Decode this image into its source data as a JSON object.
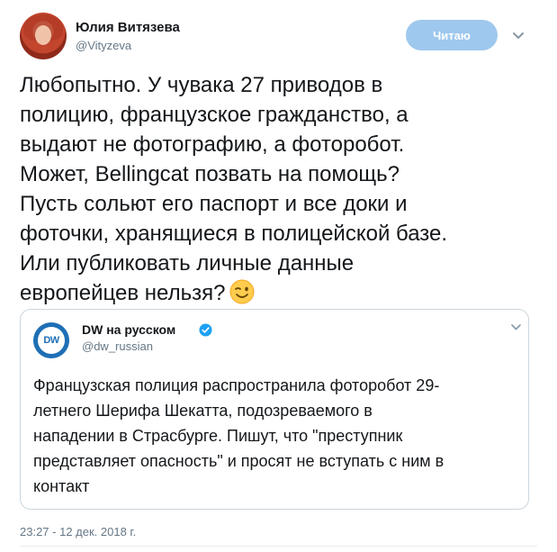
{
  "author": {
    "name": "Юлия Витязева",
    "handle": "@Vityzeva"
  },
  "follow_button": {
    "label": "Читаю"
  },
  "tweet": {
    "text": "Любопытно. У чувака 27 приводов в\nполицию, французское гражданство, а\nвыдают не фотографию, а фоторобот.\nМожет, Bellingcat позвать на помощь?\nПусть сольют его паспорт и все доки и\nфоточки, хранящиеся в полицейской базе.\nИли публиковать личные данные\nевропейцев нельзя?",
    "emoji": "winking-face-icon",
    "timestamp": "23:27 - 12 дек. 2018 г."
  },
  "quoted_tweet": {
    "logo_text": "DW",
    "name": "DW на русском",
    "handle": "@dw_russian",
    "text": "Французская полиция распространила фоторобот 29-\nлетнего Шерифа Шекатта, подозреваемого в\nнападении в Страсбурге. Пишут, что \"преступник\nпредставляет опасность\" и просят не вступать с ним в\nконтакт"
  },
  "colors": {
    "follow_button": "#9fc8ee",
    "verified": "#1da1f2",
    "dw_blue": "#1f6fb5",
    "secondary_text": "#657786"
  }
}
